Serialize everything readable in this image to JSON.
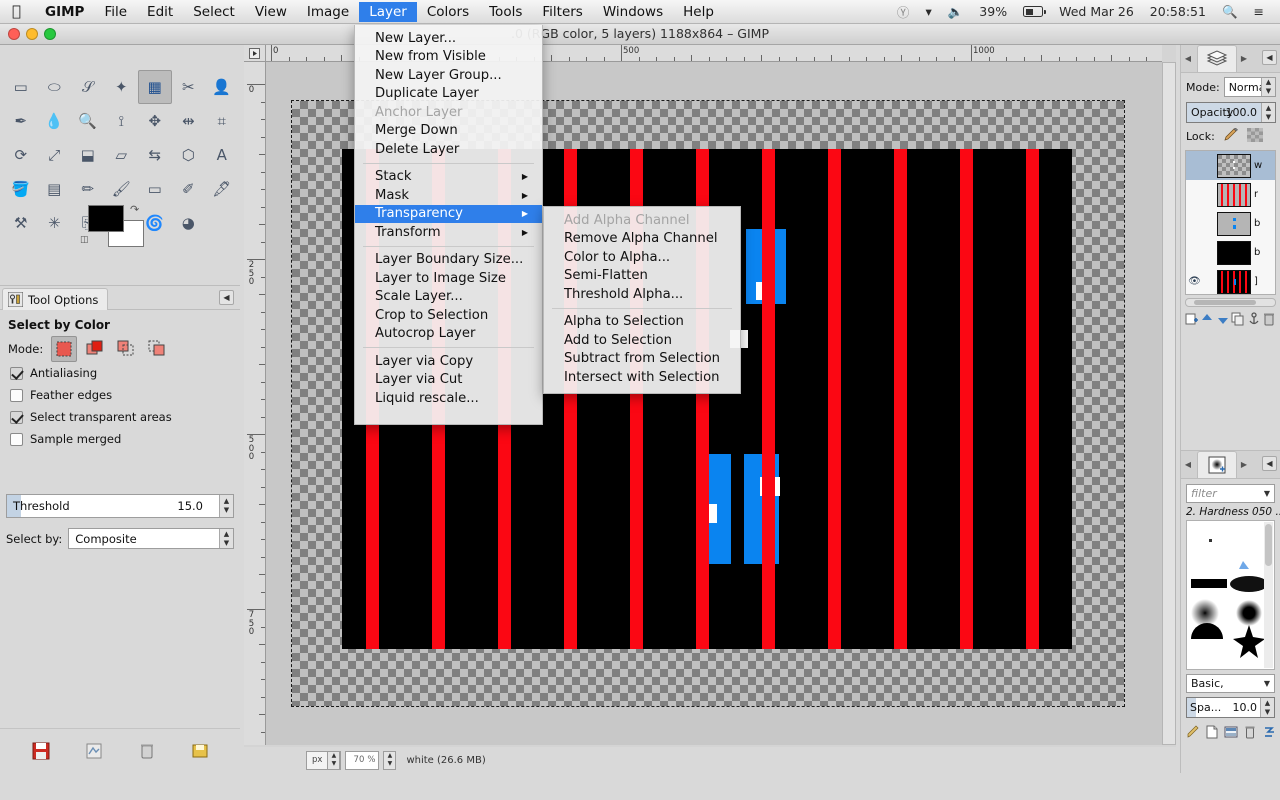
{
  "macbar": {
    "apple_icon": "apple-icon",
    "menus": [
      "GIMP",
      "File",
      "Edit",
      "Select",
      "View",
      "Image",
      "Layer",
      "Colors",
      "Tools",
      "Filters",
      "Windows",
      "Help"
    ],
    "active_menu": "Layer",
    "status": {
      "bluetooth_icon": "bluetooth-icon",
      "wifi_icon": "wifi-icon",
      "volume_icon": "volume-icon",
      "battery_percent": "39%",
      "battery_icon": "battery-icon",
      "date": "Wed Mar 26",
      "time": "20:58:51",
      "search_icon": "search-icon",
      "notifications_icon": "notification-list-icon"
    }
  },
  "window": {
    "title": ".0 (RGB color, 5 layers) 1188x864 – GIMP",
    "traffic": [
      "#ff5f57",
      "#febc2e",
      "#28c840"
    ]
  },
  "toolbox": {
    "tools": [
      {
        "name": "rect-select-tool",
        "selected": false
      },
      {
        "name": "ellipse-select-tool",
        "selected": false
      },
      {
        "name": "free-select-tool",
        "selected": false
      },
      {
        "name": "fuzzy-select-tool",
        "selected": false
      },
      {
        "name": "select-by-color-tool",
        "selected": true
      },
      {
        "name": "scissors-select-tool",
        "selected": false
      },
      {
        "name": "foreground-select-tool",
        "selected": false
      },
      {
        "name": "paths-tool",
        "selected": false
      },
      {
        "name": "color-picker-tool",
        "selected": false
      },
      {
        "name": "zoom-tool",
        "selected": false
      },
      {
        "name": "measure-tool",
        "selected": false
      },
      {
        "name": "move-tool",
        "selected": false
      },
      {
        "name": "alignment-tool",
        "selected": false
      },
      {
        "name": "crop-tool",
        "selected": false
      },
      {
        "name": "rotate-tool",
        "selected": false
      },
      {
        "name": "scale-tool",
        "selected": false
      },
      {
        "name": "shear-tool",
        "selected": false
      },
      {
        "name": "perspective-tool",
        "selected": false
      },
      {
        "name": "flip-tool",
        "selected": false
      },
      {
        "name": "cage-transform-tool",
        "selected": false
      },
      {
        "name": "text-tool",
        "selected": false
      },
      {
        "name": "bucket-fill-tool",
        "selected": false
      },
      {
        "name": "gradient-tool",
        "selected": false
      },
      {
        "name": "pencil-tool",
        "selected": false
      },
      {
        "name": "paintbrush-tool",
        "selected": false
      },
      {
        "name": "eraser-tool",
        "selected": false
      },
      {
        "name": "airbrush-tool",
        "selected": false
      },
      {
        "name": "ink-tool",
        "selected": false
      },
      {
        "name": "clone-tool",
        "selected": false
      },
      {
        "name": "heal-tool",
        "selected": false
      },
      {
        "name": "perspective-clone-tool",
        "selected": false
      },
      {
        "name": "blur-sharpen-tool",
        "selected": false
      },
      {
        "name": "smudge-tool",
        "selected": false
      },
      {
        "name": "dodge-burn-tool",
        "selected": false
      }
    ],
    "foreground_color": "#000000",
    "background_color": "#ffffff"
  },
  "tool_options": {
    "tab_label": "Tool Options",
    "tab_icon": "tool-options-icon",
    "collapse_icon": "collapse-left-icon",
    "title": "Select by Color",
    "mode_label": "Mode:",
    "modes": [
      {
        "name": "replace-selection-mode",
        "selected": true
      },
      {
        "name": "add-to-selection-mode",
        "selected": false
      },
      {
        "name": "subtract-from-selection-mode",
        "selected": false
      },
      {
        "name": "intersect-with-selection-mode",
        "selected": false
      }
    ],
    "checkboxes": [
      {
        "label": "Antialiasing",
        "checked": true,
        "name": "antialiasing-checkbox"
      },
      {
        "label": "Feather edges",
        "checked": false,
        "name": "feather-edges-checkbox"
      },
      {
        "label": "Select transparent areas",
        "checked": true,
        "name": "select-transparent-areas-checkbox"
      },
      {
        "label": "Sample merged",
        "checked": false,
        "name": "sample-merged-checkbox"
      }
    ],
    "threshold_label": "Threshold",
    "threshold_value": "15.0",
    "select_by_label": "Select by:",
    "select_by_value": "Composite"
  },
  "left_footer_icons": [
    "save-device-status-icon",
    "restore-tool-options-icon",
    "delete-tool-options-icon",
    "reset-tool-options-icon"
  ],
  "canvas": {
    "h_ruler_labels": [
      "0",
      "500",
      "1000"
    ],
    "v_ruler_labels": [
      "0",
      "250",
      "500",
      "750"
    ],
    "corner_icon": "ruler-menu-icon",
    "navigate_icon": "navigate-canvas-icon",
    "image": {
      "background": "#000000",
      "stripe_color": "#fb0713",
      "blue_color": "#0a84f0",
      "white_color": "#ffffff",
      "stripe_count": 11
    }
  },
  "statusbar": {
    "unit": "px",
    "zoom": "70",
    "zoom_suffix": "%",
    "message": "white (26.6 MB)"
  },
  "layers_dock": {
    "tab_icon": "layers-icon",
    "menu_icon": "dock-menu-icon",
    "mode_label": "Mode:",
    "mode_value": "Normal",
    "opacity_label": "Opacity",
    "opacity_value": "100.0",
    "lock_label": "Lock:",
    "lock_icons": [
      "lock-pixels-icon",
      "lock-alpha-icon"
    ],
    "layers": [
      {
        "name": "w",
        "visible": false,
        "selected": true,
        "thumb": "checker"
      },
      {
        "name": "r",
        "visible": false,
        "selected": false,
        "thumb": "red-stripes"
      },
      {
        "name": "b",
        "visible": false,
        "selected": false,
        "thumb": "blue-dots"
      },
      {
        "name": "b",
        "visible": false,
        "selected": false,
        "thumb": "black"
      },
      {
        "name": "]",
        "visible": true,
        "selected": false,
        "thumb": "composite"
      }
    ],
    "footer_icons": [
      "new-layer-icon",
      "raise-layer-icon",
      "lower-layer-icon",
      "duplicate-layer-icon",
      "anchor-layer-icon",
      "delete-layer-icon"
    ]
  },
  "brushes_dock": {
    "tab_icon": "brushes-icon",
    "menu_icon": "dock-menu-icon",
    "filter_placeholder": "filter",
    "current_brush": "2. Hardness 050 ...",
    "tag_value": "Basic,",
    "spacing_label": "Spa...",
    "spacing_value": "10.0",
    "footer_icons": [
      "edit-brush-icon",
      "new-brush-icon",
      "duplicate-brush-icon",
      "delete-brush-icon",
      "refresh-brushes-icon"
    ]
  },
  "layer_menu": {
    "items": [
      {
        "label": "New Layer...",
        "type": "item"
      },
      {
        "label": "New from Visible",
        "type": "item"
      },
      {
        "label": "New Layer Group...",
        "type": "item"
      },
      {
        "label": "Duplicate Layer",
        "type": "item"
      },
      {
        "label": "Anchor Layer",
        "type": "disabled"
      },
      {
        "label": "Merge Down",
        "type": "item"
      },
      {
        "label": "Delete Layer",
        "type": "item"
      },
      {
        "label": "",
        "type": "separator"
      },
      {
        "label": "Stack",
        "type": "submenu"
      },
      {
        "label": "Mask",
        "type": "submenu"
      },
      {
        "label": "Transparency",
        "type": "submenu-open"
      },
      {
        "label": "Transform",
        "type": "submenu"
      },
      {
        "label": "",
        "type": "separator"
      },
      {
        "label": "Layer Boundary Size...",
        "type": "item"
      },
      {
        "label": "Layer to Image Size",
        "type": "item"
      },
      {
        "label": "Scale Layer...",
        "type": "item"
      },
      {
        "label": "Crop to Selection",
        "type": "item"
      },
      {
        "label": "Autocrop Layer",
        "type": "item"
      },
      {
        "label": "",
        "type": "separator"
      },
      {
        "label": "Layer via Copy",
        "type": "item"
      },
      {
        "label": "Layer via Cut",
        "type": "item"
      },
      {
        "label": "Liquid rescale...",
        "type": "item"
      }
    ]
  },
  "transparency_menu": {
    "items": [
      {
        "label": "Add Alpha Channel",
        "type": "disabled"
      },
      {
        "label": "Remove Alpha Channel",
        "type": "item"
      },
      {
        "label": "Color to Alpha...",
        "type": "item"
      },
      {
        "label": "Semi-Flatten",
        "type": "item"
      },
      {
        "label": "Threshold Alpha...",
        "type": "item"
      },
      {
        "label": "",
        "type": "separator"
      },
      {
        "label": "Alpha to Selection",
        "type": "item"
      },
      {
        "label": "Add to Selection",
        "type": "item"
      },
      {
        "label": "Subtract from Selection",
        "type": "item"
      },
      {
        "label": "Intersect with Selection",
        "type": "item"
      }
    ]
  },
  "colors": {
    "accent": "#2f7fea",
    "red": "#fb0713",
    "blue": "#0a84f0",
    "panel": "#d9d9d9"
  }
}
